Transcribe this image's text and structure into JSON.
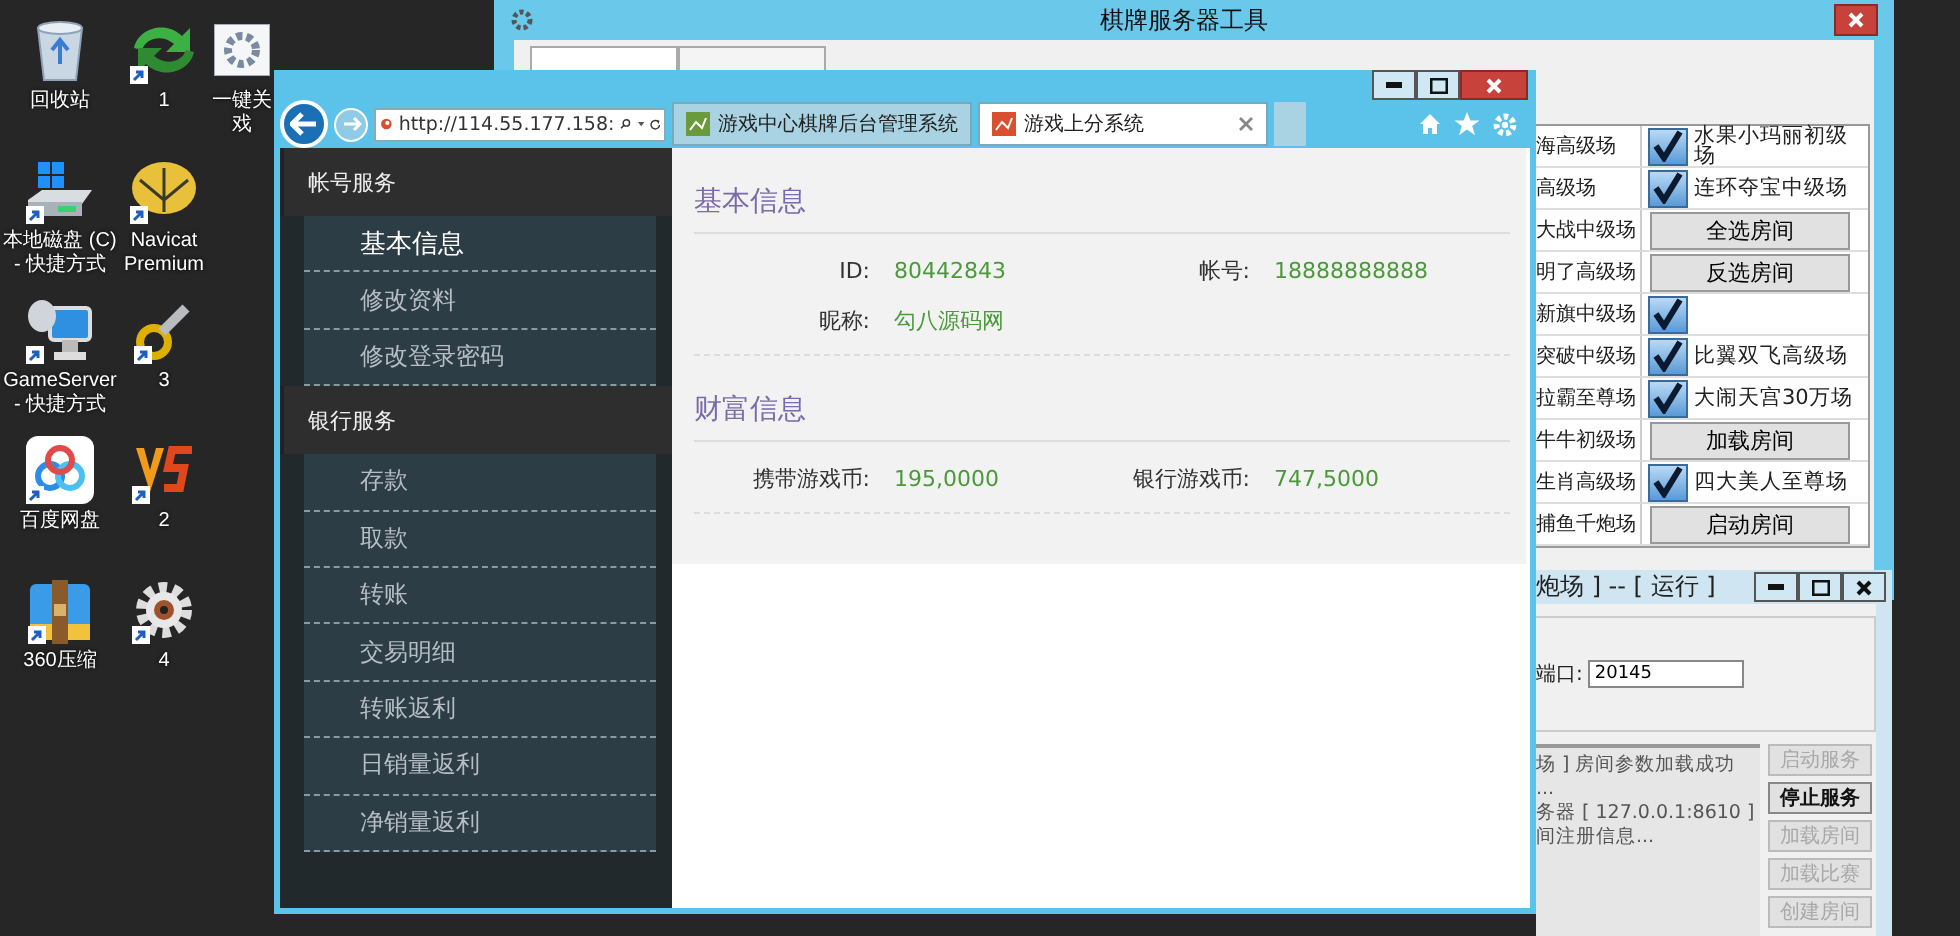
{
  "desktop": {
    "icon_columns": [
      [
        {
          "kind": "recycle-bin",
          "label_lines": [
            "回收站"
          ],
          "shortcut": false
        },
        {
          "kind": "drive",
          "label_lines": [
            "本地磁盘 (C)",
            "- 快捷方式"
          ],
          "shortcut": true
        },
        {
          "kind": "server",
          "label_lines": [
            "GameServer",
            "- 快捷方式"
          ],
          "shortcut": true
        },
        {
          "kind": "cloud",
          "label_lines": [
            "百度网盘"
          ],
          "shortcut": true
        },
        {
          "kind": "zip",
          "label_lines": [
            "360压缩"
          ],
          "shortcut": true
        }
      ],
      [
        {
          "kind": "arrows",
          "label_lines": [
            "1"
          ],
          "shortcut": true
        },
        {
          "kind": "navicat",
          "label_lines": [
            "Navicat",
            "Premium"
          ],
          "shortcut": true
        },
        {
          "kind": "key",
          "label_lines": [
            "3"
          ],
          "shortcut": true
        },
        {
          "kind": "vs",
          "label_lines": [
            "2"
          ],
          "shortcut": true
        },
        {
          "kind": "gear",
          "label_lines": [
            "4"
          ],
          "shortcut": true
        }
      ],
      [
        {
          "kind": "gear-window",
          "label_lines": [
            "一键关",
            "戏"
          ],
          "shortcut": false
        }
      ]
    ]
  },
  "server_tool_window": {
    "title": "棋牌服务器工具",
    "rooms": [
      {
        "name": "海高级场",
        "kind": "check",
        "checked": true,
        "label": "水果小玛丽初级场"
      },
      {
        "name": "高级场",
        "kind": "check",
        "checked": true,
        "label": "连环夺宝中级场"
      },
      {
        "name": "大战中级场",
        "kind": "button",
        "label": "全选房间"
      },
      {
        "name": "明了高级场",
        "kind": "button",
        "label": "反选房间"
      },
      {
        "name": "新旗中级场",
        "kind": "check",
        "checked": true
      },
      {
        "name": "突破中级场",
        "kind": "check",
        "checked": true,
        "label": "比翼双飞高级场"
      },
      {
        "name": "拉霸至尊场",
        "kind": "check",
        "checked": true,
        "label": "大闹天宫30万场"
      },
      {
        "name": "牛牛初级场",
        "kind": "button",
        "label": "加载房间"
      },
      {
        "name": "生肖高级场",
        "kind": "check",
        "checked": true,
        "label": "四大美人至尊场"
      },
      {
        "name": "捕鱼千炮场",
        "kind": "button",
        "label": "启动房间"
      }
    ]
  },
  "room_server_window": {
    "title": "炮场 ] -- [ 运行 ]",
    "port_label": "端口:",
    "port_value": "20145",
    "log_lines": [
      "场 ] 房间参数加载成功",
      "...",
      "务器 [ 127.0.0.1:8610 ]",
      "间注册信息..."
    ],
    "buttons": [
      {
        "label": "启动服务",
        "disabled": true
      },
      {
        "label": "停止服务",
        "disabled": false
      },
      {
        "label": "加载房间",
        "disabled": true
      },
      {
        "label": "加载比赛",
        "disabled": true
      },
      {
        "label": "创建房间",
        "disabled": true
      }
    ]
  },
  "browser": {
    "address": "http://114.55.177.158:",
    "tabs": [
      {
        "label": "游戏中心棋牌后台管理系统",
        "selected": false
      },
      {
        "label": "游戏上分系统",
        "selected": true
      }
    ],
    "sidebar": [
      {
        "title": "帐号服务",
        "items": [
          {
            "label": "基本信息",
            "selected": true
          },
          {
            "label": "修改资料",
            "selected": false
          },
          {
            "label": "修改登录密码",
            "selected": false
          }
        ]
      },
      {
        "title": "银行服务",
        "items": [
          {
            "label": "存款",
            "selected": false
          },
          {
            "label": "取款",
            "selected": false
          },
          {
            "label": "转账",
            "selected": false
          },
          {
            "label": "交易明细",
            "selected": false
          },
          {
            "label": "转账返利",
            "selected": false
          },
          {
            "label": "日销量返利",
            "selected": false
          },
          {
            "label": "净销量返利",
            "selected": false
          }
        ]
      }
    ],
    "content": [
      {
        "title": "基本信息",
        "rows": [
          [
            {
              "label": "ID:",
              "value": "80442843"
            },
            {
              "label": "帐号:",
              "value": "18888888888"
            }
          ],
          [
            {
              "label": "昵称:",
              "value": "勾八源码网"
            }
          ]
        ]
      },
      {
        "title": "财富信息",
        "rows": [
          [
            {
              "label": "携带游戏币:",
              "value": "195,0000"
            },
            {
              "label": "银行游戏币:",
              "value": "747,5000"
            }
          ]
        ]
      }
    ]
  }
}
